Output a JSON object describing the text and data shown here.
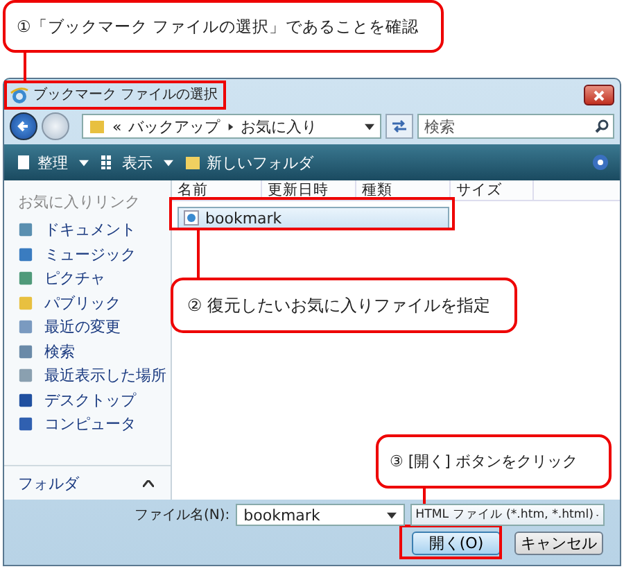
{
  "callouts": [
    {
      "text": "①「ブックマーク ファイルの選択」であることを確認"
    },
    {
      "text": "② 復元したいお気に入りファイルを指定"
    },
    {
      "text": "③ [開く] ボタンをクリック"
    }
  ],
  "window": {
    "title": "ブックマーク ファイルの選択"
  },
  "address": {
    "overflow": "«",
    "path": [
      "バックアップ",
      "お気に入り"
    ]
  },
  "search": {
    "placeholder": "検索"
  },
  "toolbar": [
    "整理",
    "表示",
    "新しいフォルダ"
  ],
  "sidebar": {
    "header": "お気に入りリンク",
    "items": [
      "ドキュメント",
      "ミュージック",
      "ピクチャ",
      "パブリック",
      "最近の変更",
      "検索",
      "最近表示した場所",
      "デスクトップ",
      "コンピュータ"
    ],
    "folders": "フォルダ"
  },
  "table": {
    "columns": [
      "名前",
      "更新日時",
      "種類",
      "サイズ"
    ],
    "rows": [
      {
        "name": "bookmark",
        "selected": true
      }
    ]
  },
  "filename": {
    "label": "ファイル名(N):",
    "value": "bookmark"
  },
  "filter": "HTML ファイル (*.htm, *.html)",
  "buttons": [
    "開く(O)",
    "キャンセル"
  ]
}
